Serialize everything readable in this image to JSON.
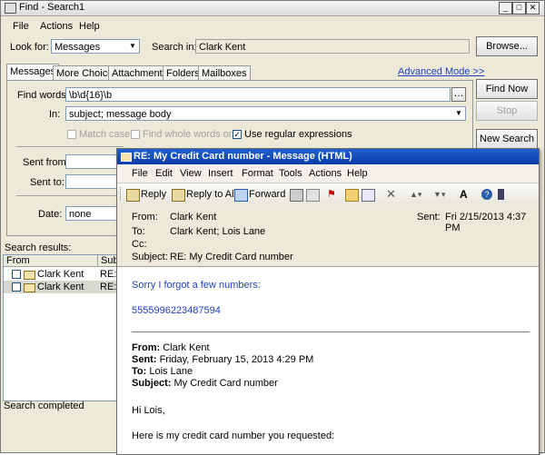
{
  "find_window": {
    "title": "Find - Search1",
    "menu": [
      "File",
      "Actions",
      "Help"
    ],
    "look_for_label": "Look for:",
    "look_for_value": "Messages",
    "search_in_label": "Search in:",
    "search_in_value": "Clark Kent",
    "browse_label": "Browse...",
    "tabs": [
      "Messages",
      "More Choices",
      "Attachments",
      "Folders",
      "Mailboxes"
    ],
    "advanced_mode": "Advanced Mode >>",
    "find_words_label": "Find words:",
    "find_words_value": "\\b\\d{16}\\b",
    "in_label": "In:",
    "in_value": "subject; message body",
    "match_case": "Match case",
    "whole_words": "Find whole words only",
    "regex": "Use regular expressions",
    "find_now": "Find Now",
    "stop": "Stop",
    "new_search": "New Search",
    "sent_from": "Sent from:",
    "sent_to": "Sent to:",
    "date_label": "Date:",
    "date_value": "none",
    "search_results": "Search results:",
    "results_cols": [
      "From",
      "Subj"
    ],
    "results_rows": [
      {
        "from": "Clark Kent",
        "subj": "RE: M"
      },
      {
        "from": "Clark Kent",
        "subj": "RE: M"
      }
    ],
    "status": "Search completed"
  },
  "message_window": {
    "title": "RE: My Credit Card number - Message (HTML)",
    "menu": [
      "File",
      "Edit",
      "View",
      "Insert",
      "Format",
      "Tools",
      "Actions",
      "Help"
    ],
    "toolbar": {
      "reply": "Reply",
      "reply_all": "Reply to All",
      "forward": "Forward"
    },
    "header": {
      "from_label": "From:",
      "from": "Clark Kent",
      "sent_label": "Sent:",
      "sent": "Fri 2/15/2013 4:37 PM",
      "to_label": "To:",
      "to": "Clark Kent; Lois Lane",
      "cc_label": "Cc:",
      "subject_label": "Subject:",
      "subject": "RE: My Credit Card number"
    },
    "body": {
      "line1": "Sorry I forgot a few numbers:",
      "line2": "5555996223487594",
      "q_from_label": "From:",
      "q_from": "Clark Kent",
      "q_sent_label": "Sent:",
      "q_sent": "Friday, February 15, 2013 4:29 PM",
      "q_to_label": "To:",
      "q_to": "Lois Lane",
      "q_subject_label": "Subject:",
      "q_subject": "My Credit Card number",
      "greeting": "Hi Lois,",
      "text": "Here is my credit card number you requested:"
    }
  },
  "colors": {
    "accent": "#0a3ca8",
    "link": "#1f3fbf"
  }
}
